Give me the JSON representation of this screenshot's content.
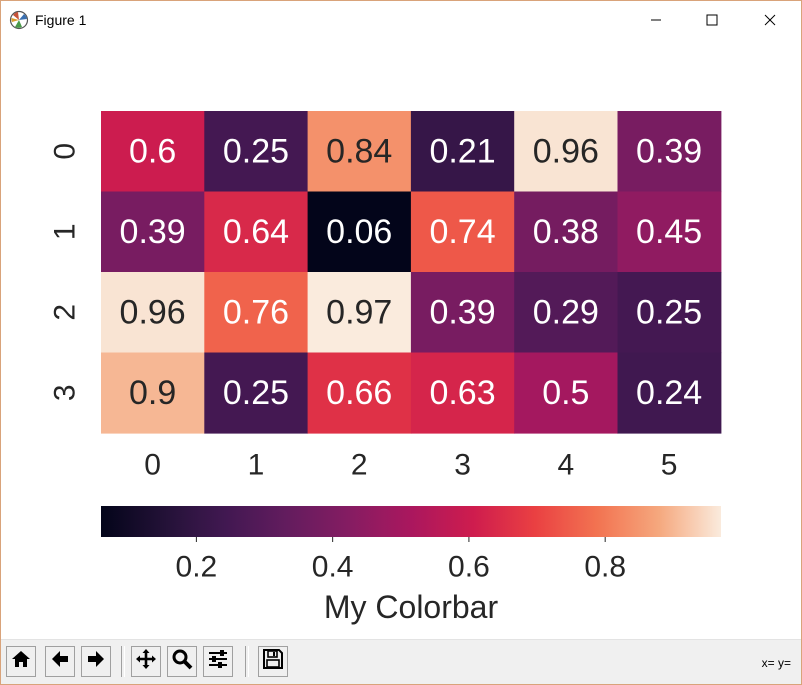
{
  "window": {
    "title": "Figure 1",
    "app_icon": "matplotlib-icon",
    "controls": [
      "minimize-icon",
      "maximize-icon",
      "close-icon"
    ]
  },
  "chart_data": {
    "type": "heatmap",
    "colormap": "rocket",
    "x_categories": [
      "0",
      "1",
      "2",
      "3",
      "4",
      "5"
    ],
    "y_categories": [
      "0",
      "1",
      "2",
      "3"
    ],
    "values": [
      [
        0.6,
        0.25,
        0.84,
        0.21,
        0.96,
        0.39
      ],
      [
        0.39,
        0.64,
        0.06,
        0.74,
        0.38,
        0.45
      ],
      [
        0.96,
        0.76,
        0.97,
        0.39,
        0.29,
        0.25
      ],
      [
        0.9,
        0.25,
        0.66,
        0.63,
        0.5,
        0.24
      ]
    ],
    "annotations": [
      [
        "0.6",
        "0.25",
        "0.84",
        "0.21",
        "0.96",
        "0.39"
      ],
      [
        "0.39",
        "0.64",
        "0.06",
        "0.74",
        "0.38",
        "0.45"
      ],
      [
        "0.96",
        "0.76",
        "0.97",
        "0.39",
        "0.29",
        "0.25"
      ],
      [
        "0.9",
        "0.25",
        "0.66",
        "0.63",
        "0.5",
        "0.24"
      ]
    ],
    "vmin": 0.06,
    "vmax": 0.97,
    "colorbar": {
      "orientation": "horizontal",
      "label": "My Colorbar",
      "ticks": [
        0.2,
        0.4,
        0.6,
        0.8
      ],
      "tick_labels": [
        "0.2",
        "0.4",
        "0.6",
        "0.8"
      ]
    },
    "grid": false
  },
  "toolbar": {
    "items": [
      {
        "icon": "home-icon",
        "name": "home-button"
      },
      {
        "icon": "arrow-left-icon",
        "name": "back-button"
      },
      {
        "icon": "arrow-right-icon",
        "name": "forward-button"
      },
      {
        "icon": "pan-icon",
        "name": "pan-button"
      },
      {
        "icon": "zoom-icon",
        "name": "zoom-button"
      },
      {
        "icon": "sliders-icon",
        "name": "configure-subplots-button"
      },
      {
        "icon": "save-icon",
        "name": "save-button"
      }
    ],
    "coords_text": "x= y="
  }
}
